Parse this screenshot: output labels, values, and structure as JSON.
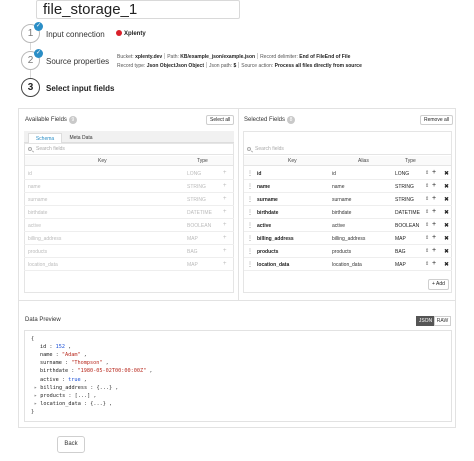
{
  "header": {
    "title_value": "file_storage_1"
  },
  "steps": [
    {
      "num": "1",
      "label": "Input connection",
      "done": true
    },
    {
      "num": "2",
      "label": "Source properties",
      "done": true
    },
    {
      "num": "3",
      "label": "Select input fields",
      "done": false
    }
  ],
  "connection": {
    "name": "Xplenty",
    "brand_color": "#d9202a"
  },
  "source_meta": {
    "bucket_label": "Bucket:",
    "bucket_value": "xplenty.dev",
    "path_label": "Path:",
    "path_value": "KB/example_json/example.json",
    "delimiter_label": "Record delimiter:",
    "delimiter_value": "End of FileEnd of File",
    "record_type_label": "Record type:",
    "record_type_value": "Json ObjectJson Object",
    "json_path_label": "Json path:",
    "json_path_value": "$",
    "source_action_label": "Source action:",
    "source_action_value": "Process all files directly from source"
  },
  "available": {
    "title": "Available Fields",
    "count": "9",
    "select_all": "Select all",
    "tabs": [
      "Schema",
      "Meta Data"
    ],
    "active_tab": "Schema",
    "search_placeholder": "Search fields",
    "col_key": "Key",
    "col_type": "Type",
    "rows": [
      {
        "key": "id",
        "type": "LONG"
      },
      {
        "key": "name",
        "type": "STRING"
      },
      {
        "key": "surname",
        "type": "STRING"
      },
      {
        "key": "birthdate",
        "type": "DATETIME"
      },
      {
        "key": "active",
        "type": "BOOLEAN"
      },
      {
        "key": "billing_address",
        "type": "MAP"
      },
      {
        "key": "products",
        "type": "BAG"
      },
      {
        "key": "location_data",
        "type": "MAP"
      }
    ]
  },
  "selected": {
    "title": "Selected Fields",
    "count": "8",
    "remove_all": "Remove all",
    "search_placeholder": "Search fields",
    "col_key": "Key",
    "col_alias": "Alias",
    "col_type": "Type",
    "rows": [
      {
        "key": "id",
        "alias": "id",
        "type": "LONG"
      },
      {
        "key": "name",
        "alias": "name",
        "type": "STRING"
      },
      {
        "key": "surname",
        "alias": "surname",
        "type": "STRING"
      },
      {
        "key": "birthdate",
        "alias": "birthdate",
        "type": "DATETIME"
      },
      {
        "key": "active",
        "alias": "active",
        "type": "BOOLEAN"
      },
      {
        "key": "billing_address",
        "alias": "billing_address",
        "type": "MAP"
      },
      {
        "key": "products",
        "alias": "products",
        "type": "BAG"
      },
      {
        "key": "location_data",
        "alias": "location_data",
        "type": "MAP"
      }
    ],
    "add_label": "+ Add"
  },
  "preview": {
    "title": "Data Preview",
    "json_label": "JSON",
    "raw_label": "RAW",
    "lines": [
      {
        "text": "{"
      },
      {
        "key": "id",
        "value": "152",
        "vtype": "n"
      },
      {
        "key": "name",
        "value": "\"Adam\"",
        "vtype": "s"
      },
      {
        "key": "surname",
        "value": "\"Thompson\"",
        "vtype": "s"
      },
      {
        "key": "birthdate",
        "value": "\"1980-05-02T00:00:00Z\"",
        "vtype": "s"
      },
      {
        "key": "active",
        "value": "true",
        "vtype": "b"
      },
      {
        "key": "billing_address",
        "value": "{...}",
        "vtype": "c",
        "collapsible": true
      },
      {
        "key": "products",
        "value": "[...]",
        "vtype": "c",
        "collapsible": true
      },
      {
        "key": "location_data",
        "value": "{...}",
        "vtype": "c",
        "collapsible": true
      },
      {
        "text": "}"
      }
    ]
  },
  "footer": {
    "back_label": "Back"
  }
}
